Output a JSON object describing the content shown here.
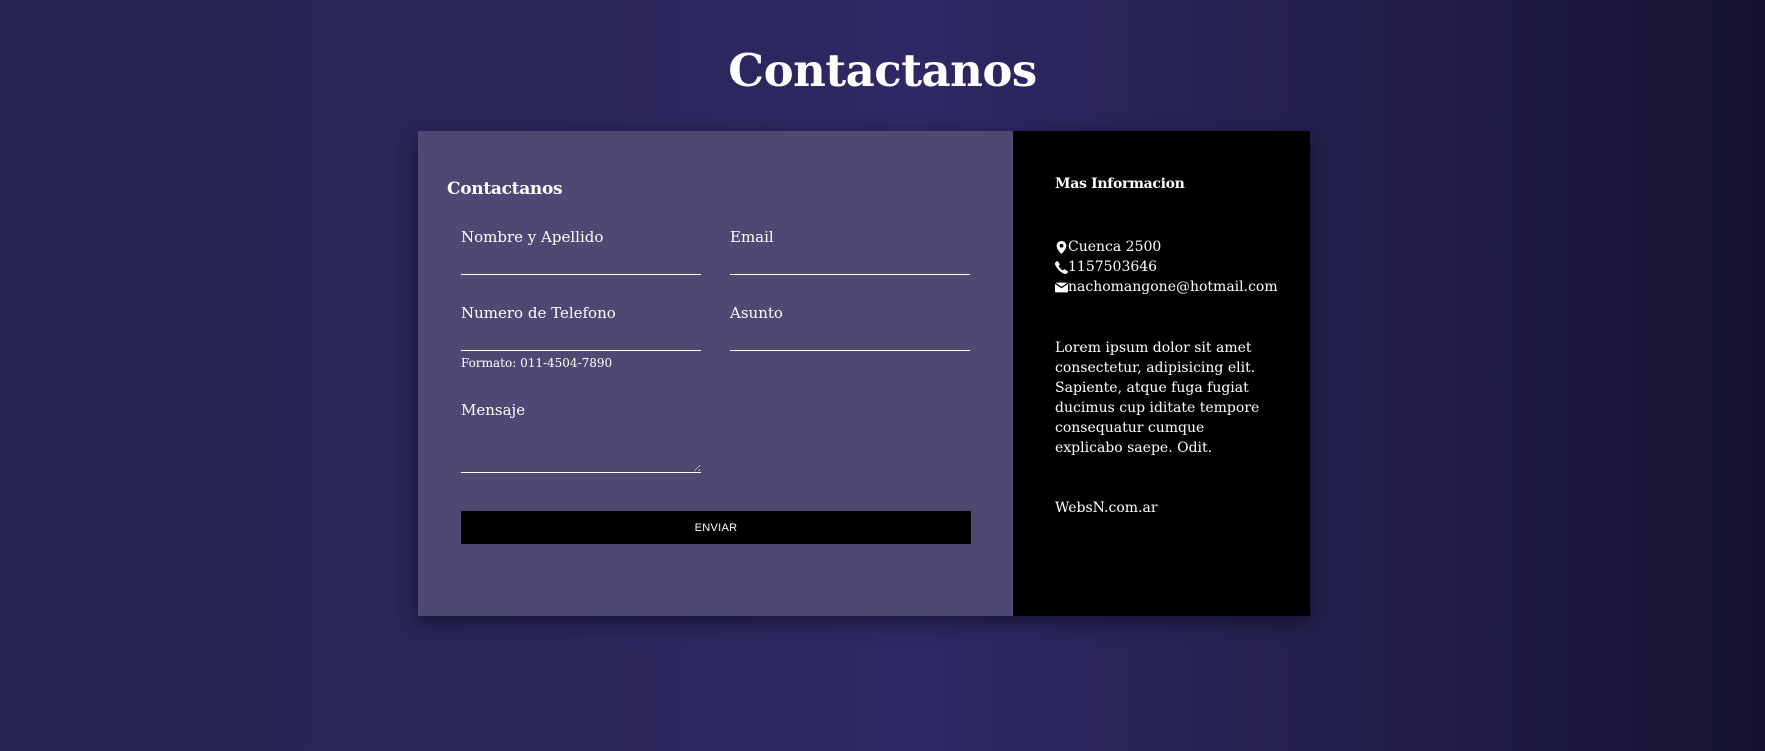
{
  "page": {
    "title": "Contactanos"
  },
  "form": {
    "heading": "Contactanos",
    "fields": {
      "name": {
        "label": "Nombre y Apellido",
        "value": ""
      },
      "email": {
        "label": "Email",
        "value": ""
      },
      "phone": {
        "label": "Numero de Telefono",
        "value": "",
        "hint": "Formato: 011-4504-7890"
      },
      "subject": {
        "label": "Asunto",
        "value": ""
      },
      "message": {
        "label": "Mensaje",
        "value": ""
      }
    },
    "submit_label": "ENVIAR"
  },
  "info": {
    "heading": "Mas Informacion",
    "contacts": [
      {
        "icon": "map-marker-icon",
        "text": "Cuenca 2500"
      },
      {
        "icon": "phone-icon",
        "text": "1157503646"
      },
      {
        "icon": "envelope-icon",
        "text": "nachomangone@hotmail.com"
      }
    ],
    "about": "Lorem ipsum dolor sit amet consectetur, adipisicing elit. Sapiente, atque fuga fugiat ducimus cup iditate tempore consequatur cumque explicabo saepe. Odit.",
    "site": "WebsN.com.ar"
  },
  "colors": {
    "form_panel": "#4f4872",
    "info_panel": "#000000",
    "button": "#000000",
    "text": "#ffffff"
  }
}
